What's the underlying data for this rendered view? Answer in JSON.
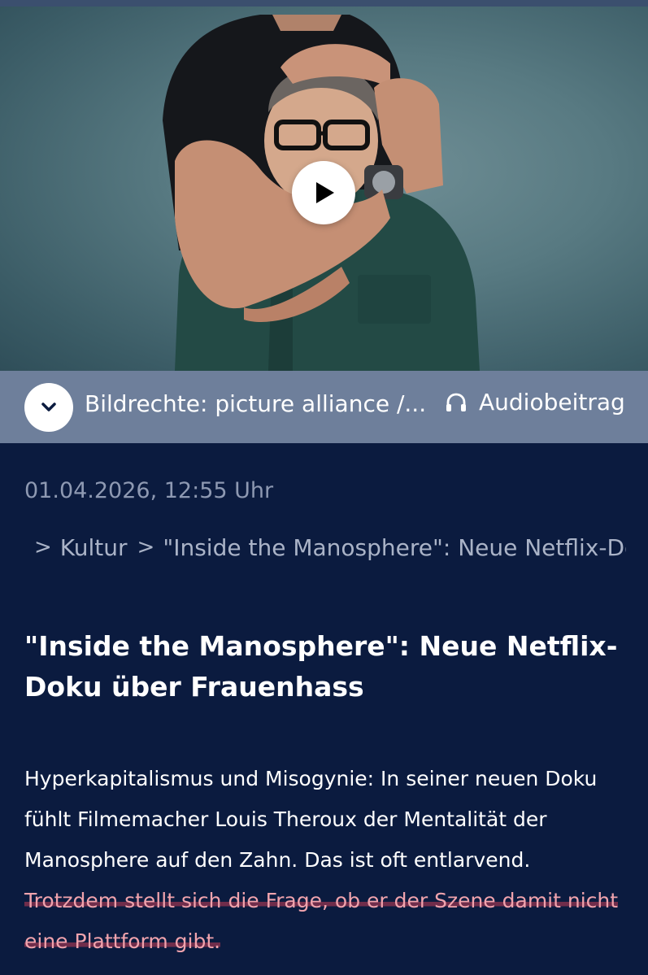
{
  "hero": {
    "play_icon": "play-icon"
  },
  "caption": {
    "credit": "Bildrechte: picture alliance /...",
    "expand_icon": "chevron-down-icon",
    "audio_label": "Audiobeitrag",
    "audio_icon": "headphones-icon"
  },
  "article": {
    "date": "01.04.2026, 12:55 Uhr",
    "breadcrumb": {
      "home_icon": "home-icon",
      "items": [
        "Kultur",
        "\"Inside the Manosphere\": Neue Netflix-Doku über Frauenhass"
      ]
    },
    "headline": "\"Inside the Manosphere\": Neue Netflix-Doku über Frauenhass",
    "teaser_plain": "Hyperkapitalismus und Misogynie: In seiner neuen Doku fühlt Filmemacher Louis Theroux der Mentalität der Manosphere auf den Zahn. Das ist oft entlarvend. ",
    "teaser_highlight": "Trotzdem stellt sich die Frage, ob er der Szene damit nicht eine Plattform gibt.",
    "highlight_color": "#c43c55"
  },
  "colors": {
    "background": "#0b1b3f",
    "caption_bar": "#6e7f9b",
    "muted_text": "#8e99b2"
  }
}
